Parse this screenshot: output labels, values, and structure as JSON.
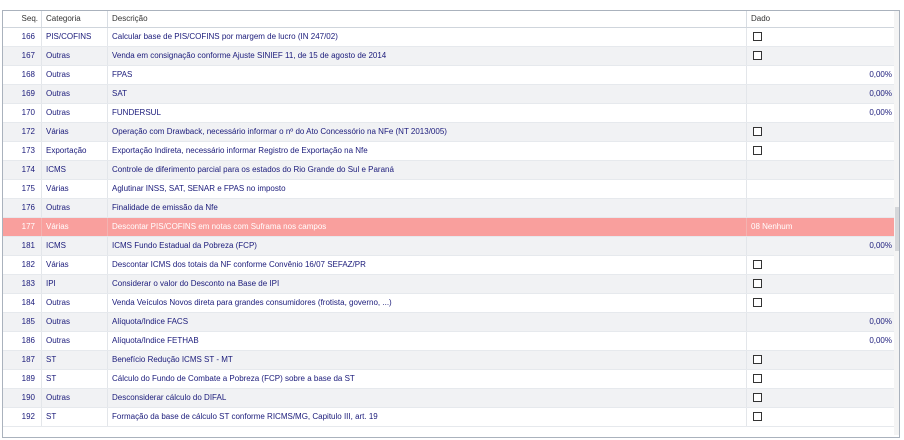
{
  "header": {
    "seq": "Seq.",
    "categoria": "Categoria",
    "descricao": "Descrição",
    "dado": "Dado"
  },
  "rows": [
    {
      "seq": "166",
      "cat": "PIS/COFINS",
      "desc": "Calcular base de PIS/COFINS por margem de lucro (IN 247/02)",
      "dado": "",
      "checkbox": true
    },
    {
      "seq": "167",
      "cat": "Outras",
      "desc": "Venda em consignação conforme Ajuste SINIEF 11, de 15 de agosto de 2014",
      "dado": "",
      "checkbox": true
    },
    {
      "seq": "168",
      "cat": "Outras",
      "desc": "FPAS",
      "dado": "0,00%",
      "checkbox": false
    },
    {
      "seq": "169",
      "cat": "Outras",
      "desc": "SAT",
      "dado": "0,00%",
      "checkbox": false
    },
    {
      "seq": "170",
      "cat": "Outras",
      "desc": "FUNDERSUL",
      "dado": "0,00%",
      "checkbox": false
    },
    {
      "seq": "172",
      "cat": "Várias",
      "desc": "Operação com Drawback, necessário informar o nº do Ato Concessório na NFe (NT 2013/005)",
      "dado": "",
      "checkbox": true
    },
    {
      "seq": "173",
      "cat": "Exportação",
      "desc": "Exportação Indireta, necessário informar Registro de Exportação na Nfe",
      "dado": "",
      "checkbox": true
    },
    {
      "seq": "174",
      "cat": "ICMS",
      "desc": "Controle de diferimento parcial para os estados do Rio Grande do Sul e Paraná",
      "dado": "",
      "checkbox": false
    },
    {
      "seq": "175",
      "cat": "Várias",
      "desc": "Aglutinar INSS, SAT, SENAR e FPAS no imposto",
      "dado": "",
      "checkbox": false
    },
    {
      "seq": "176",
      "cat": "Outras",
      "desc": "Finalidade de emissão da Nfe",
      "dado": "",
      "checkbox": false
    },
    {
      "seq": "177",
      "cat": "Várias",
      "desc": "Descontar PIS/COFINS em notas com Suframa nos campos",
      "dado": "08 Nenhum",
      "checkbox": false,
      "selected": true
    },
    {
      "seq": "181",
      "cat": "ICMS",
      "desc": "ICMS Fundo Estadual da Pobreza (FCP)",
      "dado": "0,00%",
      "checkbox": false
    },
    {
      "seq": "182",
      "cat": "Várias",
      "desc": "Descontar ICMS dos totais da NF conforme Convênio 16/07 SEFAZ/PR",
      "dado": "",
      "checkbox": true
    },
    {
      "seq": "183",
      "cat": "IPI",
      "desc": "Considerar o valor do Desconto na Base de IPI",
      "dado": "",
      "checkbox": true
    },
    {
      "seq": "184",
      "cat": "Outras",
      "desc": "Venda Veículos Novos direta para grandes consumidores (frotista, governo, ...)",
      "dado": "",
      "checkbox": true
    },
    {
      "seq": "185",
      "cat": "Outras",
      "desc": "Alíquota/Indice FACS",
      "dado": "0,00%",
      "checkbox": false
    },
    {
      "seq": "186",
      "cat": "Outras",
      "desc": "Alíquota/Indice FETHAB",
      "dado": "0,00%",
      "checkbox": false
    },
    {
      "seq": "187",
      "cat": "ST",
      "desc": "Benefício Redução ICMS ST - MT",
      "dado": "",
      "checkbox": true
    },
    {
      "seq": "189",
      "cat": "ST",
      "desc": "Cálculo do Fundo de Combate a Pobreza (FCP) sobre a base da ST",
      "dado": "",
      "checkbox": true
    },
    {
      "seq": "190",
      "cat": "Outras",
      "desc": "Desconsiderar cálculo do DIFAL",
      "dado": "",
      "checkbox": true
    },
    {
      "seq": "192",
      "cat": "ST",
      "desc": "Formação da base de cálculo ST conforme RICMS/MG, Capitulo III, art. 19",
      "dado": "",
      "checkbox": true
    }
  ]
}
